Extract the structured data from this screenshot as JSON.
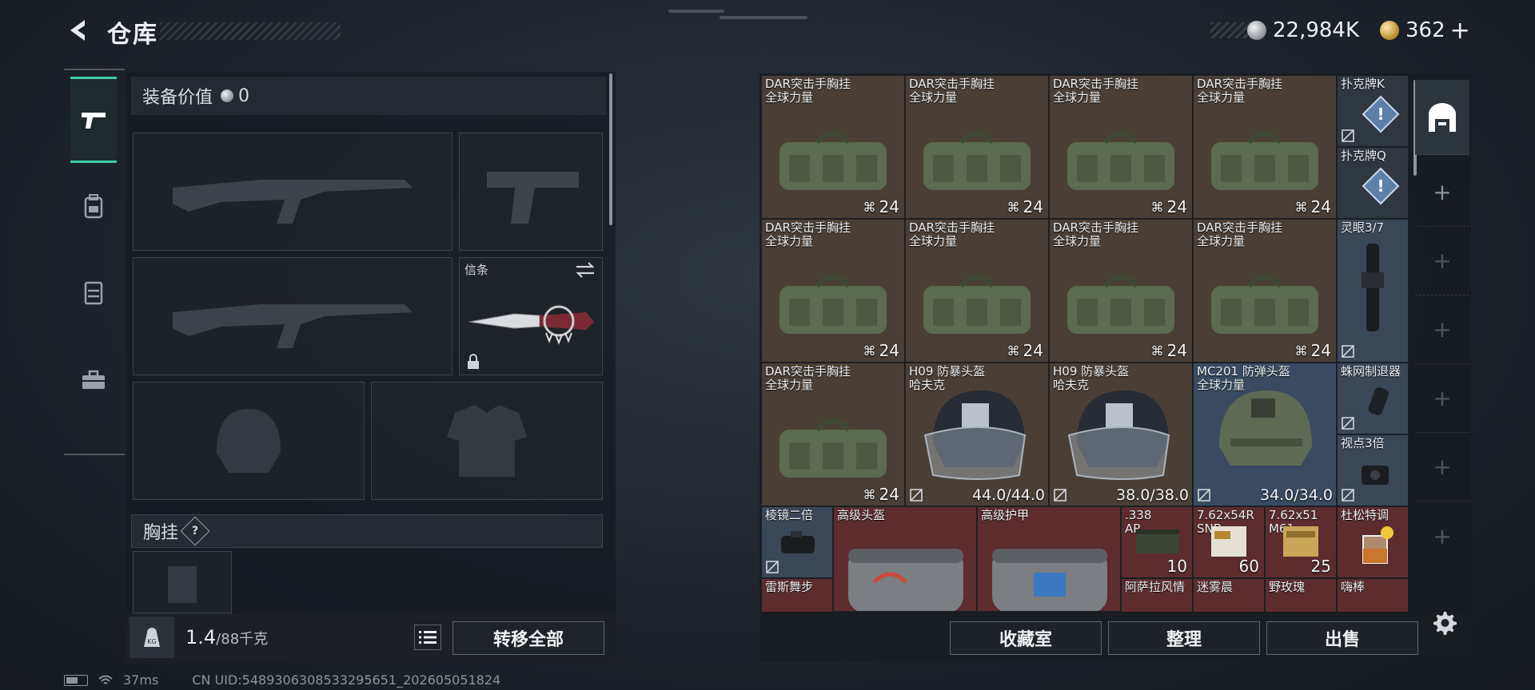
{
  "header": {
    "title": "仓库",
    "currency_silver": "22,984K",
    "currency_gold": "362",
    "add_symbol": "+"
  },
  "left_panel": {
    "equip_value_label": "装备价值",
    "equip_value": "0",
    "slots": {
      "primary_1": "",
      "secondary": "",
      "primary_2": "",
      "melee_label": "信条",
      "helmet": "",
      "armor": ""
    },
    "chest_rig_label": "胸挂",
    "chest_rig_help": "?",
    "weight_value": "1.4",
    "weight_capacity": "/88千克",
    "transfer_all": "转移全部"
  },
  "storage": {
    "items": [
      {
        "name": "DAR突击手胸挂",
        "sub": "全球力量",
        "count": "24",
        "color": "brown"
      },
      {
        "name": "DAR突击手胸挂",
        "sub": "全球力量",
        "count": "24",
        "color": "brown"
      },
      {
        "name": "DAR突击手胸挂",
        "sub": "全球力量",
        "count": "24",
        "color": "brown"
      },
      {
        "name": "DAR突击手胸挂",
        "sub": "全球力量",
        "count": "24",
        "color": "brown"
      },
      {
        "name": "DAR突击手胸挂",
        "sub": "全球力量",
        "count": "24",
        "color": "brown"
      },
      {
        "name": "DAR突击手胸挂",
        "sub": "全球力量",
        "count": "24",
        "color": "brown"
      },
      {
        "name": "DAR突击手胸挂",
        "sub": "全球力量",
        "count": "24",
        "color": "brown"
      },
      {
        "name": "DAR突击手胸挂",
        "sub": "全球力量",
        "count": "24",
        "color": "brown"
      },
      {
        "name": "DAR突击手胸挂",
        "sub": "全球力量",
        "count": "24",
        "color": "brown"
      }
    ],
    "small_items": {
      "card_k": "扑克牌K",
      "card_q": "扑克牌Q",
      "scope_37": "灵眼3/7",
      "suppressor": "蛛网制退器",
      "sight_3x": "视点3倍",
      "scope_2x": "棱镜二倍",
      "ammo_338": ".338\nAP",
      "ammo_338_count": "10",
      "ammo_762r": "7.62x54R\nSNB",
      "ammo_762r_count": "60",
      "ammo_76251": "7.62x51\nM61",
      "ammo_76251_count": "25",
      "whiskey": "杜松特调",
      "rhythm": "雷斯舞步",
      "afp": "阿萨拉风情",
      "fog": "迷雾晨",
      "rose": "野玫瑰",
      "hi": "嗨棒"
    },
    "helmets": [
      {
        "name": "H09 防暴头盔",
        "sub": "哈夫克",
        "durability": "44.0/44.0"
      },
      {
        "name": "H09 防暴头盔",
        "sub": "哈夫克",
        "durability": "38.0/38.0"
      },
      {
        "name": "MC201 防弹头盔",
        "sub": "全球力量",
        "durability": "34.0/34.0"
      }
    ],
    "cases": {
      "helmet_case": "高级头盔",
      "armor_case": "高级护甲"
    }
  },
  "bottom_buttons": {
    "collection": "收藏室",
    "organize": "整理",
    "sell": "出售"
  },
  "status_bar": {
    "ping": "37ms",
    "uid": "CN UID:5489306308533295651_202605051824"
  },
  "colors": {
    "accent": "#3fc9a4",
    "brown_cell": "#4a3f36",
    "red_cell": "#5c2c2f",
    "blue_cell": "#3a4a60"
  }
}
